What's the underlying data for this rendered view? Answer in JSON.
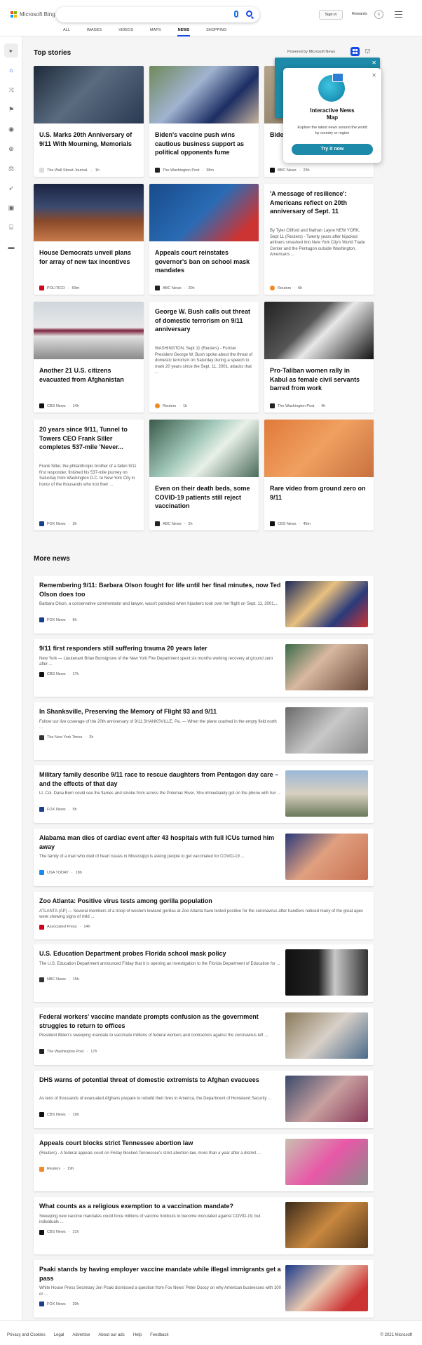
{
  "header": {
    "logo": "Microsoft Bing",
    "signin": "Sign in",
    "rewards": "Rewards",
    "tabs": [
      "ALL",
      "IMAGES",
      "VIDEOS",
      "MAPS",
      "NEWS",
      "SHOPPING"
    ]
  },
  "top": {
    "title": "Top stories",
    "powered": "Powered by Microsoft News",
    "cards": [
      {
        "title": "U.S. Marks 20th Anniversary of 9/11 With Mourning, Memorials",
        "snippet": "",
        "source": "The Wall Street Journal.",
        "age": "1h"
      },
      {
        "title": "Biden's vaccine push wins cautious business support as political opponents fume",
        "snippet": "",
        "source": "The Washington Post",
        "age": "38m"
      },
      {
        "title": "Biden",
        "snippet": "",
        "source": "BBC News",
        "age": "23h"
      },
      {
        "title": "House Democrats unveil plans for array of new tax incentives",
        "snippet": "",
        "source": "POLITICO",
        "age": "59m"
      },
      {
        "title": "Appeals court reinstates governor's ban on school mask mandates",
        "snippet": "",
        "source": "ABC News",
        "age": "20h"
      },
      {
        "title": "'A message of resilience': Americans reflect on 20th anniversary of Sept. 11",
        "snippet": "By Tyler Clifford and Nathan Layne NEW YORK, Sept 11 (Reuters) - Twenty years after hijacked airliners smashed into New York City's World Trade Center and the Pentagon outside Washington, Americans ...",
        "source": "Reuters",
        "age": "6h"
      },
      {
        "title": "Another 21 U.S. citizens evacuated from Afghanistan",
        "snippet": "",
        "source": "CBS News",
        "age": "14h"
      },
      {
        "title": "George W. Bush calls out threat of domestic terrorism on 9/11 anniversary",
        "snippet": "WASHINGTON, Sept 11 (Reuters) - Former President George W. Bush spoke about the threat of domestic terrorism on Saturday during a speech to mark 20 years since the Sept. 11, 2001, attacks that ...",
        "source": "Reuters",
        "age": "1h"
      },
      {
        "title": "Pro-Taliban women rally in Kabul as female civil servants barred from work",
        "snippet": "",
        "source": "The Washington Post",
        "age": "4h"
      },
      {
        "title": "20 years since 9/11, Tunnel to Towers CEO Frank Siller completes 537-mile 'Never...",
        "snippet": "Frank Siller, the philanthropic brother of a fallen 9/11 first responder, finished his 537-mile journey on Saturday from Washington D.C. to New York City in honor of the thousands who lost their ...",
        "source": "FOX News",
        "age": "3h"
      },
      {
        "title": "Even on their death beds, some COVID-19 patients still reject vaccination",
        "snippet": "",
        "source": "ABC News",
        "age": "2h"
      },
      {
        "title": "Rare video from ground zero on 9/11",
        "snippet": "",
        "source": "CBS News",
        "age": "45m"
      }
    ]
  },
  "popup": {
    "title": "Interactive News Map",
    "desc": "Explore the latest news around the world by country or region",
    "button": "Try it now"
  },
  "more": {
    "title": "More news",
    "items": [
      {
        "title": "Remembering 9/11: Barbara Olson fought for life until her final minutes, now Ted Olson does too",
        "snippet": "Barbara Olson, a conservative commentator and lawyer, wasn't panicked when hijackers took over her flight on Sept. 11, 2001,...",
        "source": "FOX News",
        "age": "6h"
      },
      {
        "title": "9/11 first responders still suffering trauma 20 years later",
        "snippet": "New York — Lieutenant Brian Bonsignore of the New York Fire Department spent six months working recovery at ground zero after ...",
        "source": "CBS News",
        "age": "17h"
      },
      {
        "title": "In Shanksville, Preserving the Memory of Flight 93 and 9/11",
        "snippet": "Follow our live coverage of the 20th anniversary of 9/11.SHANKSVILLE, Pa. — When the plane crashed in the empty field north ...",
        "source": "The New York Times",
        "age": "2h"
      },
      {
        "title": "Military family describe 9/11 race to rescue daughters from Pentagon day care – and the effects of that day",
        "snippet": "Lt. Col. Dana Born could see the flames and smoke from across the Potomac River. She immediately got on the phone with her ...",
        "source": "FOX News",
        "age": "5h"
      },
      {
        "title": "Alabama man dies of cardiac event after 43 hospitals with full ICUs turned him away",
        "snippet": "The family of a man who died of heart issues in Mississippi is asking people to get vaccinated for COVID-19 ...",
        "source": "USA TODAY",
        "age": "18h"
      },
      {
        "title": "Zoo Atlanta: Positive virus tests among gorilla population",
        "snippet": "ATLANTA (AP) — Several members of a troop of western lowland gorillas at Zoo Atlanta have tested positive for the coronavirus after handlers noticed many of the great apes were showing signs of mild ...",
        "source": "Associated Press",
        "age": "14h"
      },
      {
        "title": "U.S. Education Department probes Florida school mask policy",
        "snippet": "The U.S. Education Department announced Friday that it is opening an investigation to the Florida Department of Education for ...",
        "source": "NBC News",
        "age": "15h"
      },
      {
        "title": "Federal workers' vaccine mandate prompts confusion as the government struggles to return to offices",
        "snippet": "President Biden's sweeping mandate to vaccinate millions of federal workers and contractors against the coronavirus left ...",
        "source": "The Washington Post",
        "age": "17h"
      },
      {
        "title": "DHS warns of potential threat of domestic extremists to Afghan evacuees",
        "snippet": "As tens of thousands of evacuated Afghans prepare to rebuild their lives in America, the Department of Homeland Security ...",
        "source": "CBS News",
        "age": "19h"
      },
      {
        "title": "Appeals court blocks strict Tennessee abortion law",
        "snippet": "(Reuters) - A federal appeals court on Friday blocked Tennessee's strict abortion law, more than a year after a district ...",
        "source": "Reuters",
        "age": "19h"
      },
      {
        "title": "What counts as a religious exemption to a vaccination mandate?",
        "snippet": "Sweeping new vaccine mandates could force millions of vaccine holdouts to become inoculated against COVID-19, but individuals ...",
        "source": "CBS News",
        "age": "21h"
      },
      {
        "title": "Psaki stands by having employer vaccine mandate while illegal immigrants get a pass",
        "snippet": "White House Press Secretary Jen Psaki dismissed a question from Fox News' Peter Doocy on why American businesses with 100 or ...",
        "source": "FOX News",
        "age": "20h"
      }
    ]
  },
  "footer": {
    "links": [
      "Privacy and Cookies",
      "Legal",
      "Advertise",
      "About our ads",
      "Help",
      "Feedback"
    ],
    "copyright": "© 2021 Microsoft"
  }
}
